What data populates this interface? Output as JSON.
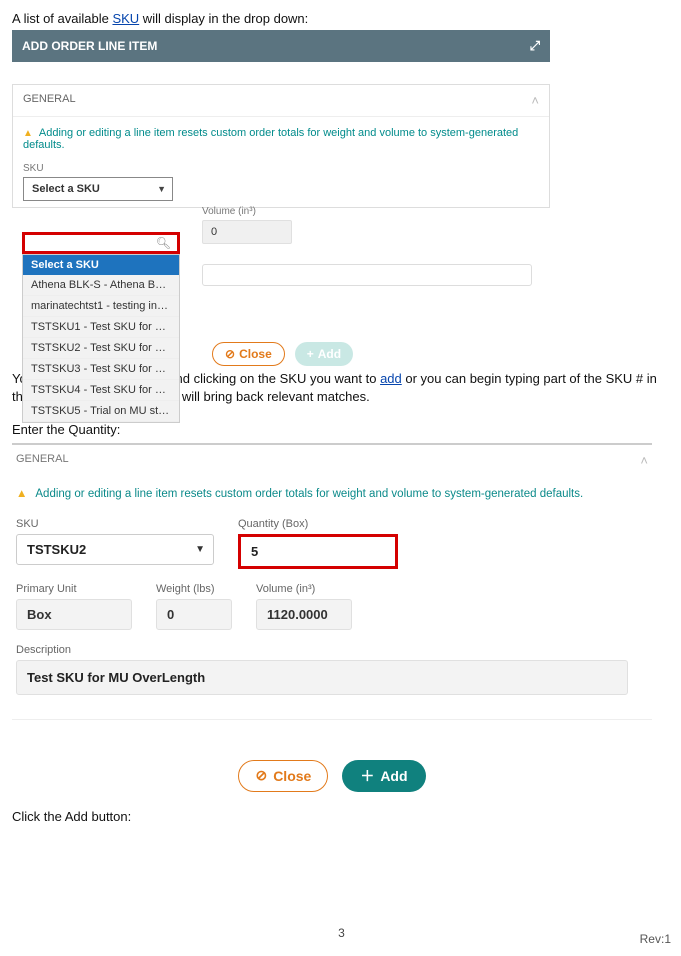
{
  "intro": {
    "prefix": "A list of available ",
    "link": "SKU",
    "suffix": " will display in the drop down:"
  },
  "shot1": {
    "header": "ADD ORDER LINE ITEM",
    "panel_title": "GENERAL",
    "warning": "Adding or editing a line item resets custom order totals for weight and volume to system-generated defaults.",
    "sku_label": "SKU",
    "sku_placeholder": "Select a SKU",
    "volume_label": "Volume (in³)",
    "volume_value": "0",
    "dropdown": {
      "selected": "Select a SKU",
      "items": [
        "Athena BLK-S - Athena BLK-S",
        "marinatechtst1 - testing inne...",
        "TSTSKU1 - Test SKU for MU St...",
        "TSTSKU2 - Test SKU for MU O...",
        "TSTSKU3 - Test SKU for MU O...",
        "TSTSKU4 - Test SKU for MU O...",
        "TSTSKU5 - Trial on MU storag..."
      ]
    },
    "close_btn": "Close",
    "add_btn": "Add"
  },
  "mid_text": {
    "p1a": "You can select by scrolling and clicking on the SKU you want to ",
    "p1link": "add",
    "p1b": " or you can begin typing part of the SKU # in the search field and Extensiv will bring back relevant matches.",
    "p2": "Enter the Quantity:"
  },
  "shot2": {
    "panel_title": "GENERAL",
    "warning": "Adding or editing a line item resets custom order totals for weight and volume to system-generated defaults.",
    "sku_label": "SKU",
    "sku_value": "TSTSKU2",
    "qty_label": "Quantity (Box)",
    "qty_value": "5",
    "pu_label": "Primary Unit",
    "pu_value": "Box",
    "wt_label": "Weight (lbs)",
    "wt_value": "0",
    "vol_label": "Volume (in³)",
    "vol_value": "1120.0000",
    "desc_label": "Description",
    "desc_value": "Test SKU for MU OverLength",
    "close_btn": "Close",
    "add_btn": "Add"
  },
  "outro": "Click the Add button:",
  "footer": {
    "page": "3",
    "rev": "Rev:1"
  }
}
